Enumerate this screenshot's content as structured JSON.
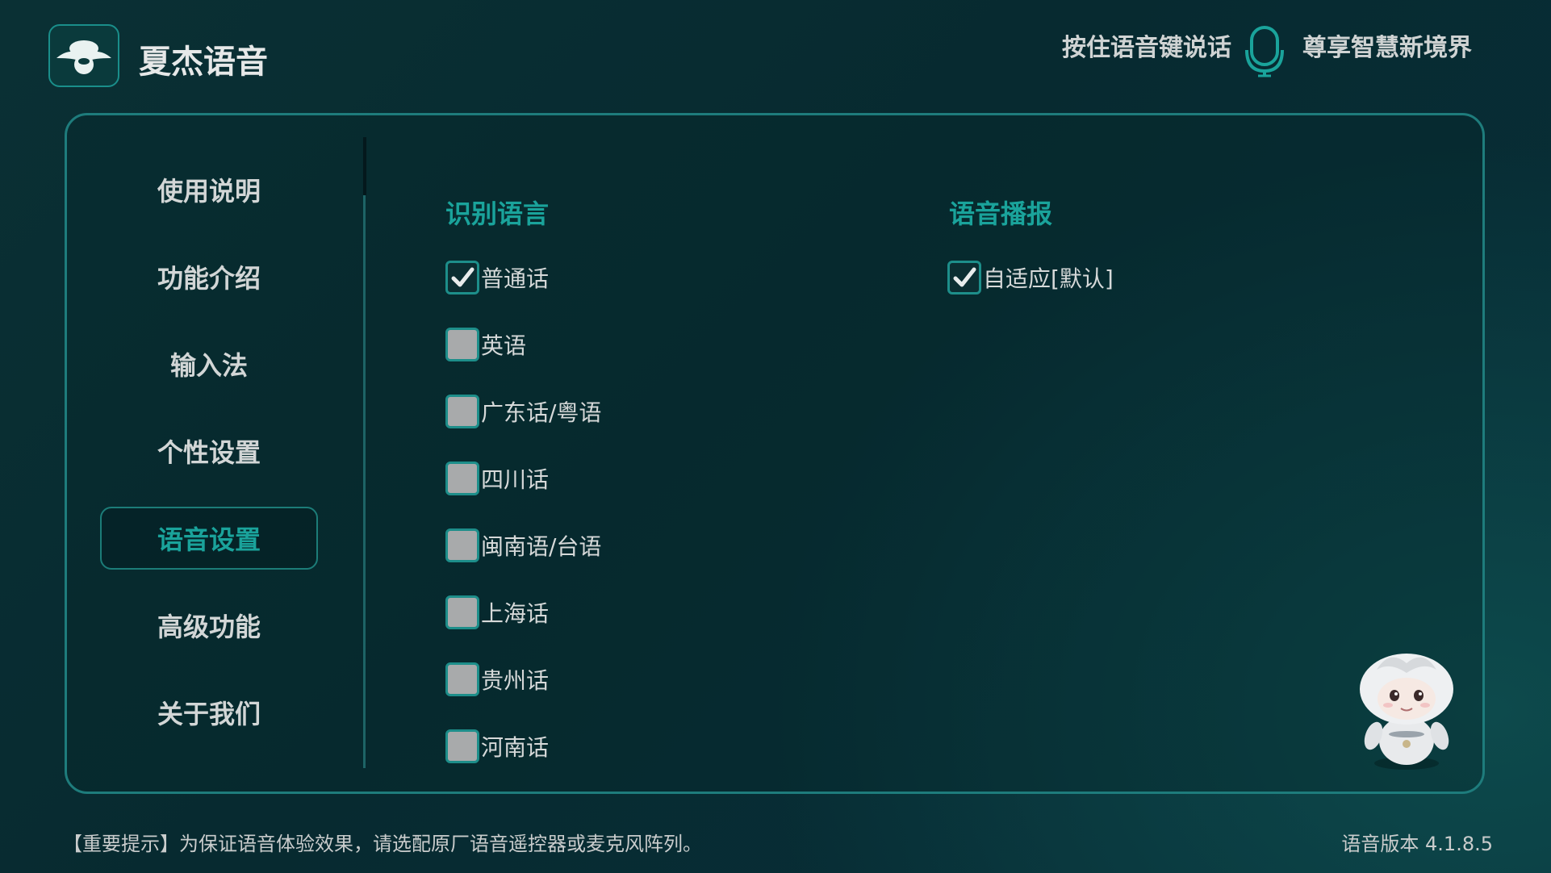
{
  "header": {
    "app_title": "夏杰语音",
    "hint_left": "按住语音键说话",
    "hint_right": "尊享智慧新境界",
    "logo_icon": "app-logo-icon",
    "mic_icon": "microphone-icon"
  },
  "sidebar": {
    "items": [
      {
        "label": "使用说明",
        "active": false
      },
      {
        "label": "功能介绍",
        "active": false
      },
      {
        "label": "输入法",
        "active": false
      },
      {
        "label": "个性设置",
        "active": false
      },
      {
        "label": "语音设置",
        "active": true
      },
      {
        "label": "高级功能",
        "active": false
      },
      {
        "label": "关于我们",
        "active": false
      }
    ]
  },
  "recognition": {
    "title": "识别语言",
    "options": [
      {
        "label": "普通话",
        "checked": true
      },
      {
        "label": "英语",
        "checked": false
      },
      {
        "label": "广东话/粤语",
        "checked": false
      },
      {
        "label": "四川话",
        "checked": false
      },
      {
        "label": "闽南语/台语",
        "checked": false
      },
      {
        "label": "上海话",
        "checked": false
      },
      {
        "label": "贵州话",
        "checked": false
      },
      {
        "label": "河南话",
        "checked": false
      }
    ]
  },
  "broadcast": {
    "title": "语音播报",
    "options": [
      {
        "label": "自适应[默认]",
        "checked": true
      }
    ]
  },
  "footer": {
    "note": "【重要提示】为保证语音体验效果，请选配原厂语音遥控器或麦克风阵列。",
    "version": "语音版本  4.1.8.5"
  },
  "colors": {
    "accent": "#1aa39b",
    "border": "#1e7c7c",
    "unchecked_box": "#a8aaab"
  }
}
